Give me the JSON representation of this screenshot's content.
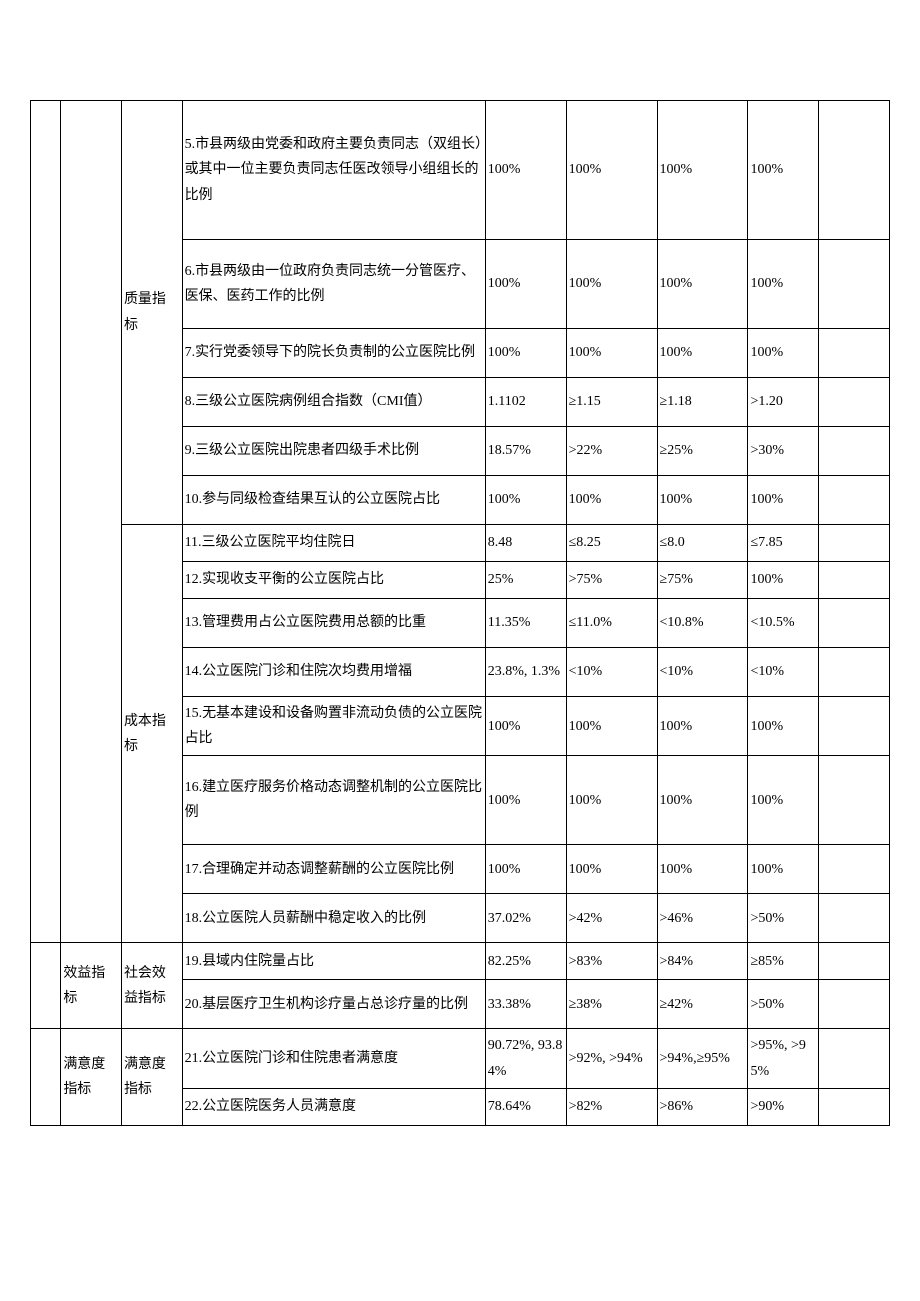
{
  "groups": {
    "quality": "质量指标",
    "cost": "成本指标",
    "benefit_l1": "效益指标",
    "benefit_l2": "社会效益指标",
    "satisfaction_l1": "满意度指标",
    "satisfaction_l2": "满意度指标"
  },
  "rows": {
    "r5": {
      "name": "5.市县两级由党委和政府主要负责同志（双组长）或其中一位主要负责同志任医改领导小组组长的比例",
      "c1": "100%",
      "c2": "100%",
      "c3": "100%",
      "c4": "100%"
    },
    "r6": {
      "name": "6.市县两级由一位政府负责同志统一分管医疗、医保、医药工作的比例",
      "c1": "100%",
      "c2": "100%",
      "c3": "100%",
      "c4": "100%"
    },
    "r7": {
      "name": "7.实行党委领导下的院长负责制的公立医院比例",
      "c1": "100%",
      "c2": "100%",
      "c3": "100%",
      "c4": "100%"
    },
    "r8": {
      "name": "8.三级公立医院病例组合指数（CMI值）",
      "c1": "1.1102",
      "c2": "≥1.15",
      "c3": "≥1.18",
      "c4": ">1.20"
    },
    "r9": {
      "name": "9.三级公立医院出院患者四级手术比例",
      "c1": "18.57%",
      "c2": ">22%",
      "c3": "≥25%",
      "c4": ">30%"
    },
    "r10": {
      "name": "10.参与同级检查结果互认的公立医院占比",
      "c1": "100%",
      "c2": "100%",
      "c3": "100%",
      "c4": "100%"
    },
    "r11": {
      "name": "11.三级公立医院平均住院日",
      "c1": "8.48",
      "c2": "≤8.25",
      "c3": "≤8.0",
      "c4": "≤7.85"
    },
    "r12": {
      "name": "12.实现收支平衡的公立医院占比",
      "c1": "25%",
      "c2": ">75%",
      "c3": "≥75%",
      "c4": "100%"
    },
    "r13": {
      "name": "13.管理费用占公立医院费用总额的比重",
      "c1": "11.35%",
      "c2": "≤11.0%",
      "c3": "<10.8%",
      "c4": "<10.5%"
    },
    "r14": {
      "name": "14.公立医院门诊和住院次均费用增福",
      "c1": "23.8%, 1.3%",
      "c2": "<10%",
      "c3": "<10%",
      "c4": "<10%"
    },
    "r15": {
      "name": "15.无基本建设和设备购置非流动负债的公立医院占比",
      "c1": "100%",
      "c2": "100%",
      "c3": "100%",
      "c4": "100%"
    },
    "r16": {
      "name": "16.建立医疗服务价格动态调整机制的公立医院比例",
      "c1": "100%",
      "c2": "100%",
      "c3": "100%",
      "c4": "100%"
    },
    "r17": {
      "name": "17.合理确定并动态调整薪酬的公立医院比例",
      "c1": "100%",
      "c2": "100%",
      "c3": "100%",
      "c4": "100%"
    },
    "r18": {
      "name": "18.公立医院人员薪酬中稳定收入的比例",
      "c1": "37.02%",
      "c2": ">42%",
      "c3": ">46%",
      "c4": ">50%"
    },
    "r19": {
      "name": "19.县域内住院量占比",
      "c1": "82.25%",
      "c2": ">83%",
      "c3": ">84%",
      "c4": "≥85%"
    },
    "r20": {
      "name": "20.基层医疗卫生机构诊疗量占总诊疗量的比例",
      "c1": "33.38%",
      "c2": "≥38%",
      "c3": "≥42%",
      "c4": ">50%"
    },
    "r21": {
      "name": "21.公立医院门诊和住院患者满意度",
      "c1": "90.72%, 93.84%",
      "c2": ">92%, >94%",
      "c3": ">94%,≥95%",
      "c4": ">95%, >95%"
    },
    "r22": {
      "name": "22.公立医院医务人员满意度",
      "c1": "78.64%",
      "c2": ">82%",
      "c3": ">86%",
      "c4": ">90%"
    }
  }
}
